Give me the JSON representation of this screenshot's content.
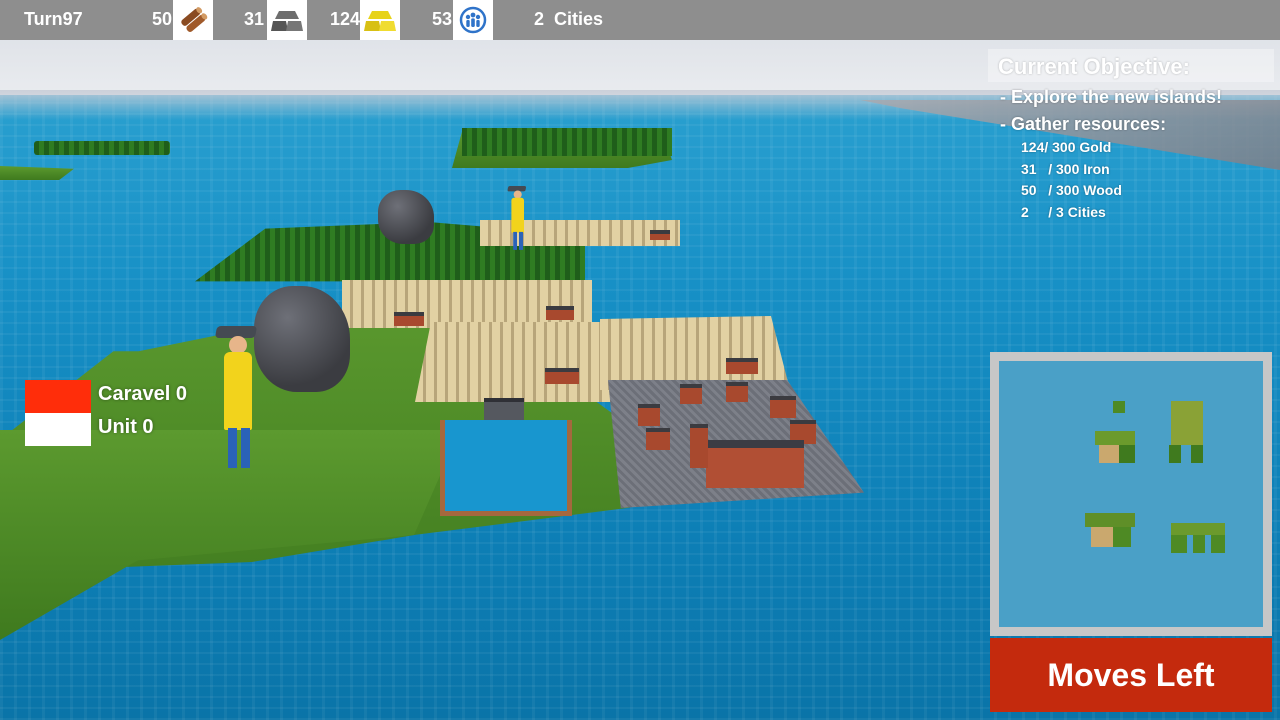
{
  "hud": {
    "turn": "Turn97",
    "resources": [
      {
        "name": "wood",
        "value": "50",
        "icon": "wood-icon"
      },
      {
        "name": "iron",
        "value": "31",
        "icon": "iron-icon"
      },
      {
        "name": "gold",
        "value": "124",
        "icon": "gold-icon"
      },
      {
        "name": "population",
        "value": "53",
        "icon": "population-icon"
      }
    ],
    "cities": "2  Cities"
  },
  "objective": {
    "title": "Current Objective:",
    "lines": [
      "- Explore the new islands!",
      "- Gather resources:"
    ],
    "progress": [
      "124/ 300 Gold",
      "31   / 300 Iron",
      "50   / 300 Wood",
      "2     / 3 Cities"
    ]
  },
  "legend": [
    {
      "label": "Caravel 0",
      "color": "#ff2d0a"
    },
    {
      "label": "Unit 0",
      "color": "#ffffff"
    }
  ],
  "minimap": {
    "name": "minimap"
  },
  "moves_button": {
    "label": "Moves Left",
    "color": "#c42a0d"
  },
  "colors": {
    "hud_bar": "#8e8e8e",
    "ocean": "#1790c6",
    "grass": "#4f8a27",
    "minimap_water": "#4aa0c7"
  }
}
